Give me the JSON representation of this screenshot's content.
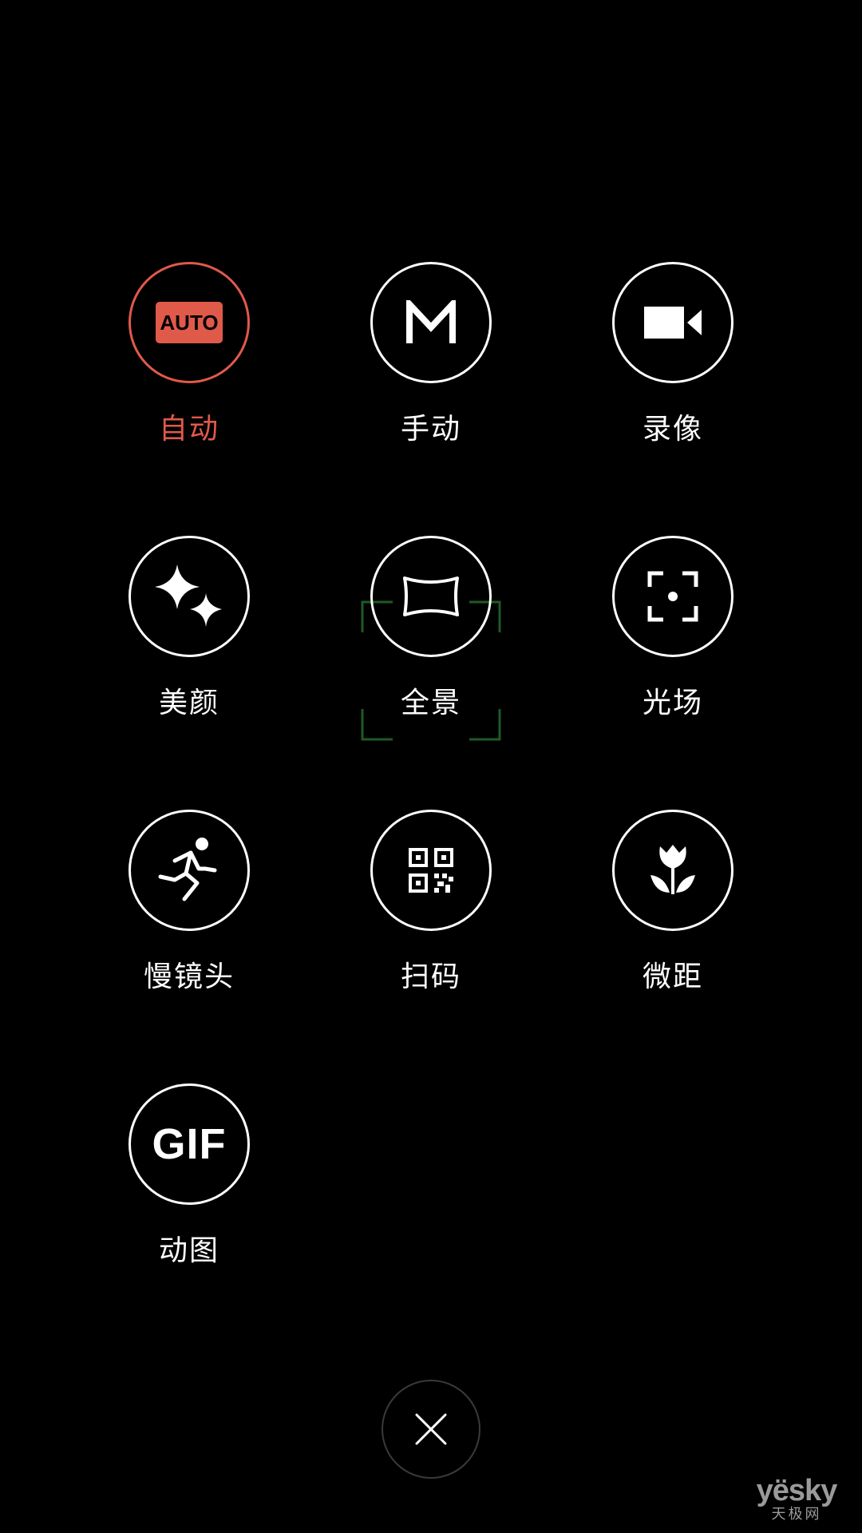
{
  "theme": {
    "background": "#000000",
    "foreground": "#ffffff",
    "accent": "#e05a4a",
    "focus_frame": "#1f5a24"
  },
  "modes": [
    {
      "id": "auto",
      "label": "自动",
      "icon": "auto-badge-icon",
      "badge_text": "AUTO",
      "active": true
    },
    {
      "id": "manual",
      "label": "手动",
      "icon": "m-letter-icon",
      "active": false
    },
    {
      "id": "video",
      "label": "录像",
      "icon": "video-camera-icon",
      "active": false
    },
    {
      "id": "beauty",
      "label": "美颜",
      "icon": "sparkle-icon",
      "active": false
    },
    {
      "id": "panorama",
      "label": "全景",
      "icon": "panorama-icon",
      "active": false
    },
    {
      "id": "light-field",
      "label": "光场",
      "icon": "focus-frame-icon",
      "active": false
    },
    {
      "id": "slow-motion",
      "label": "慢镜头",
      "icon": "running-person-icon",
      "active": false
    },
    {
      "id": "scan",
      "label": "扫码",
      "icon": "qr-code-icon",
      "active": false
    },
    {
      "id": "macro",
      "label": "微距",
      "icon": "tulip-icon",
      "active": false
    },
    {
      "id": "gif",
      "label": "动图",
      "icon": "gif-icon",
      "badge_text": "GIF",
      "active": false
    }
  ],
  "close_button": {
    "icon": "close-icon"
  },
  "watermark": {
    "top": "yësky",
    "bottom": "天极网"
  }
}
